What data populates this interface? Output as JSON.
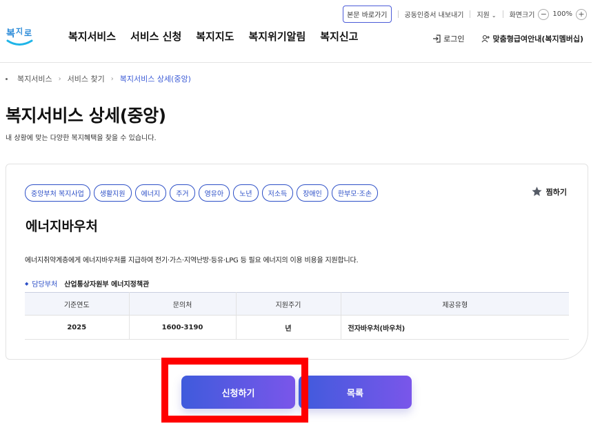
{
  "utility": {
    "skip_label": "본문 바로가기",
    "cert_label": "공동인증서 내보내기",
    "lang_label": "지원",
    "zoom_label": "화면크기",
    "zoom_out": "−",
    "zoom_value": "100%",
    "zoom_in": "+"
  },
  "gnb": {
    "items": [
      "복지서비스",
      "서비스 신청",
      "복지지도",
      "복지위기알림",
      "복지신고"
    ]
  },
  "member": {
    "login_label": "로그인",
    "custom_label": "맞춤형급여안내(복지멤버십)"
  },
  "breadcrumb": [
    "복지서비스",
    "서비스 찾기",
    "복지서비스 상세(중앙)"
  ],
  "page": {
    "title": "복지서비스 상세(중앙)",
    "subtitle": "내 상황에 맞는 다양한 복지혜택을 찾을 수 있습니다."
  },
  "service": {
    "tags": [
      "중앙부처 복지사업",
      "생활지원",
      "에너지",
      "주거",
      "영유아",
      "노년",
      "저소득",
      "장애인",
      "한부모·조손"
    ],
    "favorite_label": "찜하기",
    "name": "에너지바우처",
    "description": "에너지취약계층에게 에너지바우처를 지급하여 전기·가스·지역난방·등유·LPG 등 필요 에너지의 이용 비용을 지원합니다.",
    "dept_label": "담당부처",
    "dept_value": "산업통상자원부 에너지정책관",
    "table": {
      "headers": [
        "기준연도",
        "문의처",
        "지원주기",
        "제공유형"
      ],
      "row": [
        "2025",
        "1600-3190",
        "년",
        "전자바우처(바우처)"
      ]
    }
  },
  "buttons": {
    "apply_label": "신청하기",
    "list_label": "목록"
  },
  "colors": {
    "accent": "#2c4fc7",
    "button_start": "#3f5bdc",
    "button_end": "#7a56ea",
    "highlight": "#ff0000"
  }
}
